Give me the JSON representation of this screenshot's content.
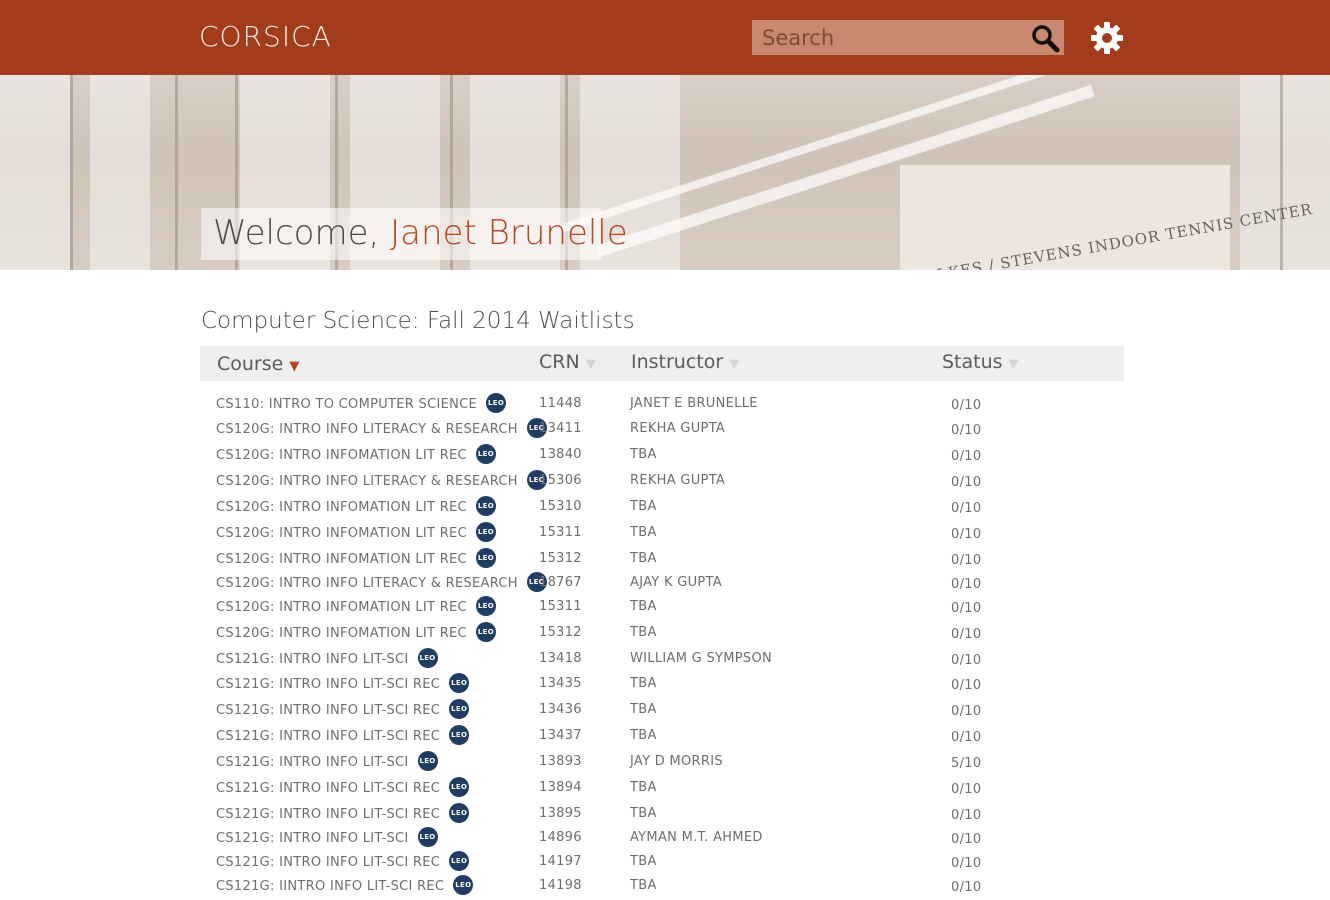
{
  "header": {
    "brand": "CORSICA",
    "search_placeholder": "Search"
  },
  "hero": {
    "welcome_prefix": "Welcome, ",
    "user_name": "Janet Brunelle",
    "sign_text": "FOLKES / STEVENS  INDOOR TENNIS CENTER"
  },
  "section_title": "Computer Science: Fall 2014 Waitlists",
  "table": {
    "columns": [
      "Course",
      "CRN",
      "Instructor",
      "Status"
    ],
    "rows": [
      {
        "course": "CS110: Intro to Computer Science",
        "crn": "11448",
        "instructor": "Janet E Brunelle",
        "status": "0/10"
      },
      {
        "course": "CS120G: Intro Info Literacy & Research",
        "crn": "13411",
        "instructor": "Rekha Gupta",
        "status": "0/10"
      },
      {
        "course": "CS120G: Intro Infomation Lit Rec",
        "crn": "13840",
        "instructor": "TBA",
        "status": "0/10"
      },
      {
        "course": "CS120G: Intro Info Literacy & Research",
        "crn": "15306",
        "instructor": "Rekha Gupta",
        "status": "0/10"
      },
      {
        "course": "CS120G: Intro Infomation Lit Rec",
        "crn": "15310",
        "instructor": "TBA",
        "status": "0/10"
      },
      {
        "course": "CS120G: Intro Infomation Lit Rec",
        "crn": "15311",
        "instructor": "TBA",
        "status": "0/10"
      },
      {
        "course": "CS120G: Intro Infomation Lit Rec",
        "crn": "15312",
        "instructor": "TBA",
        "status": "0/10"
      },
      {
        "course": "CS120G: Intro Info Literacy & Research",
        "crn": "18767",
        "instructor": "Ajay K Gupta",
        "status": "0/10"
      },
      {
        "course": "CS120G: Intro Infomation Lit Rec",
        "crn": "15311",
        "instructor": "TBA",
        "status": "0/10"
      },
      {
        "course": "CS120G: Intro Infomation Lit Rec",
        "crn": "15312",
        "instructor": "TBA",
        "status": "0/10"
      },
      {
        "course": "CS121G: Intro Info Lit-Sci",
        "crn": "13418",
        "instructor": "William G Sympson",
        "status": "0/10"
      },
      {
        "course": "CS121G: Intro Info Lit-Sci Rec",
        "crn": "13435",
        "instructor": "TBA",
        "status": "0/10"
      },
      {
        "course": "CS121G: Intro Info Lit-Sci Rec",
        "crn": "13436",
        "instructor": "TBA",
        "status": "0/10"
      },
      {
        "course": "CS121G: Intro Info Lit-Sci Rec",
        "crn": "13437",
        "instructor": "TBA",
        "status": "0/10"
      },
      {
        "course": "CS121G: Intro Info Lit-Sci",
        "crn": "13893",
        "instructor": "Jay D Morris",
        "status": "5/10"
      },
      {
        "course": "CS121G: Intro Info Lit-Sci Rec",
        "crn": "13894",
        "instructor": "TBA",
        "status": "0/10"
      },
      {
        "course": "CS121G: Intro Info Lit-Sci Rec",
        "crn": "13895",
        "instructor": "TBA",
        "status": "0/10"
      },
      {
        "course": "CS121G: Intro Info Lit-Sci",
        "crn": "14896",
        "instructor": "Ayman M.T. Ahmed",
        "status": "0/10"
      },
      {
        "course": "CS121G: Intro Info Lit-Sci Rec",
        "crn": "14197",
        "instructor": "TBA",
        "status": "0/10"
      },
      {
        "course": "CS121G: IIntro Info Lit-Sci Rec",
        "crn": "14198",
        "instructor": "TBA",
        "status": "0/10"
      }
    ]
  },
  "badge_label": "LEO",
  "colors": {
    "header_bg": "#a33c1c",
    "accent": "#b5441f",
    "badge_bg": "#1f3d62"
  },
  "icons": {
    "search": "search-icon",
    "settings": "gear-icon"
  }
}
